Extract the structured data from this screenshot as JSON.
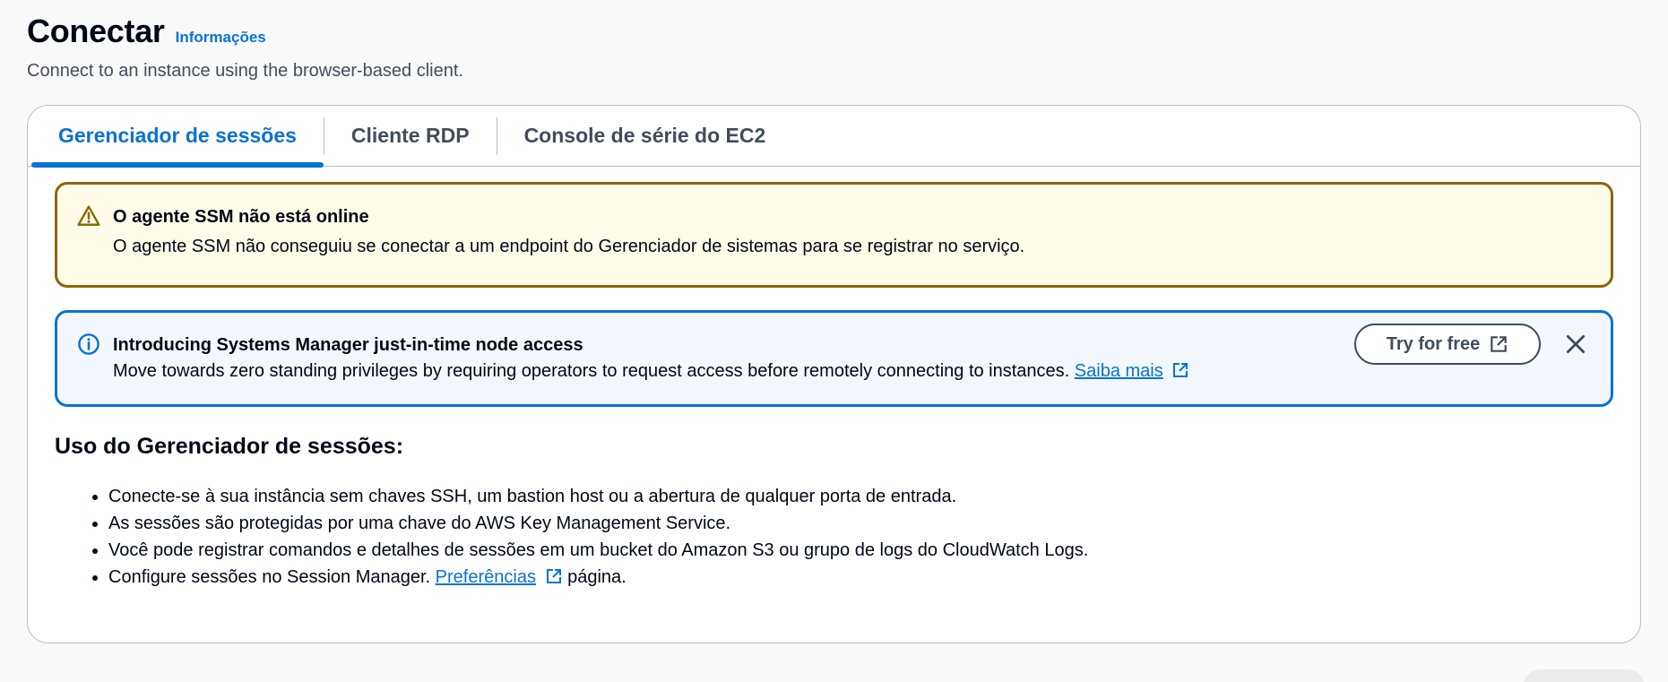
{
  "header": {
    "title": "Conectar",
    "info_link": "Informações",
    "description": "Connect to an instance using the browser-based client."
  },
  "tabs": [
    {
      "label": "Gerenciador de sessões",
      "active": true
    },
    {
      "label": "Cliente RDP",
      "active": false
    },
    {
      "label": "Console de série do EC2",
      "active": false
    }
  ],
  "warning_alert": {
    "icon": "warning-icon",
    "title": "O agente SSM não está online",
    "text": "O agente SSM não conseguiu se conectar a um endpoint do Gerenciador de sistemas para se registrar no serviço."
  },
  "info_alert": {
    "icon": "info-icon",
    "title": "Introducing Systems Manager just-in-time node access",
    "text": "Move towards zero standing privileges by requiring operators to request access before remotely connecting to instances.",
    "link_label": "Saiba mais",
    "button_label": "Try for free"
  },
  "section": {
    "title": "Uso do Gerenciador de sessões:",
    "bullets": [
      "Conecte-se à sua instância sem chaves SSH, um bastion host ou a abertura de qualquer porta de entrada.",
      "As sessões são protegidas por uma chave do AWS Key Management Service.",
      "Você pode registrar comandos e detalhes de sessões em um bucket do Amazon S3 ou grupo de logs do CloudWatch Logs."
    ],
    "last_bullet": {
      "prefix": "Configure sessões no Session Manager.",
      "link_label": "Preferências",
      "suffix": "página."
    }
  },
  "colors": {
    "accent": "#0972d3",
    "warning_border": "#8d6605",
    "warning_bg": "#fffce9",
    "info_bg": "#f2f8fd"
  }
}
